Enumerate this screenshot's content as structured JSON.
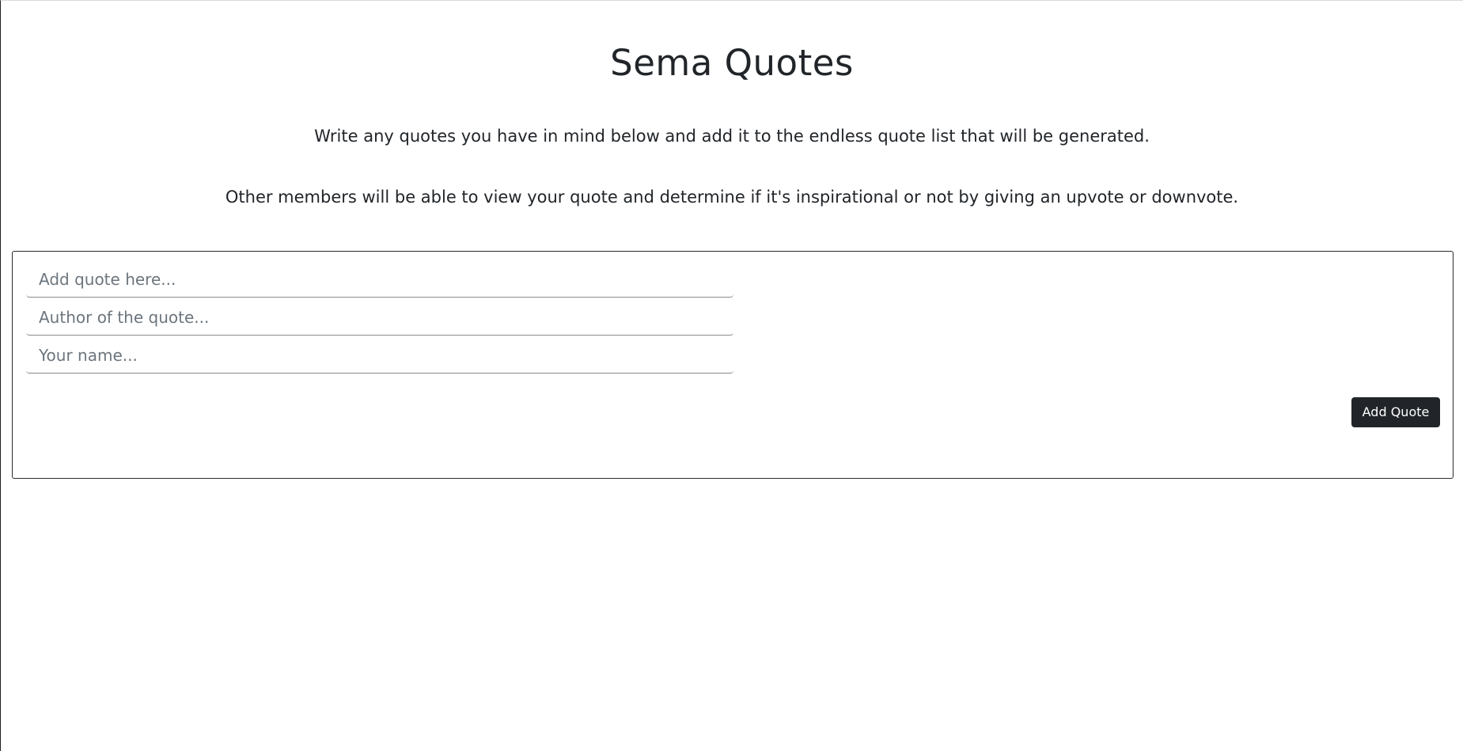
{
  "header": {
    "title": "Sema Quotes",
    "description_1": "Write any quotes you have in mind below and add it to the endless quote list that will be generated.",
    "description_2": "Other members will be able to view your quote and determine if it's inspirational or not by giving an upvote or downvote."
  },
  "form": {
    "quote": {
      "value": "",
      "placeholder": "Add quote here..."
    },
    "author": {
      "value": "",
      "placeholder": "Author of the quote..."
    },
    "name": {
      "value": "",
      "placeholder": "Your name..."
    },
    "submit_label": "Add Quote"
  },
  "colors": {
    "text": "#212529",
    "placeholder": "#6c757d",
    "button_bg": "#212529",
    "button_text": "#ffffff",
    "card_border": "#2b2b2b"
  }
}
